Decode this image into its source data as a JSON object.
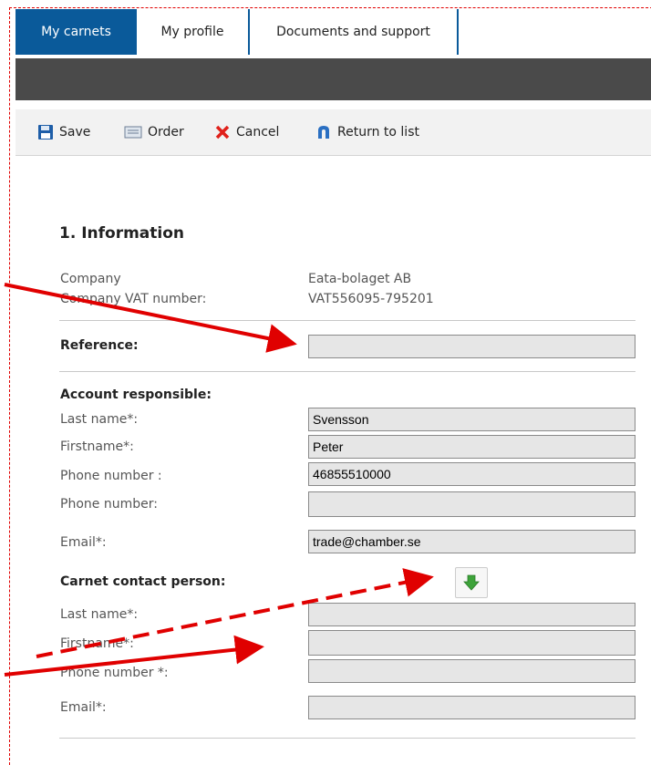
{
  "tabs": [
    "My carnets",
    "My profile",
    "Documents and support"
  ],
  "toolbar": {
    "save": "Save",
    "order": "Order",
    "cancel": "Cancel",
    "return": "Return to list"
  },
  "section_title": "1. Information",
  "company": {
    "label": "Company",
    "value": "Eata-bolaget AB"
  },
  "vat": {
    "label": "Company VAT number:",
    "value": "VAT556095-795201"
  },
  "reference": {
    "label": "Reference:",
    "value": ""
  },
  "account": {
    "title": "Account responsible:",
    "last_name": {
      "label": "Last name*:",
      "value": "Svensson"
    },
    "first_name": {
      "label": "Firstname*:",
      "value": "Peter"
    },
    "phone1": {
      "label": "Phone number :",
      "value": "46855510000"
    },
    "phone2": {
      "label": "Phone number:",
      "value": ""
    },
    "email": {
      "label": "Email*:",
      "value": "trade@chamber.se"
    }
  },
  "contact": {
    "title": "Carnet contact person:",
    "last_name": {
      "label": "Last name*:",
      "value": ""
    },
    "first_name": {
      "label": "Firstname*:",
      "value": ""
    },
    "phone": {
      "label": "Phone number *:",
      "value": ""
    },
    "email": {
      "label": "Email*:",
      "value": ""
    }
  },
  "icons": {
    "save": "floppy-disk-icon",
    "order": "order-icon",
    "cancel": "red-x-icon",
    "return": "return-arrow-icon",
    "copy": "green-down-arrow-icon"
  },
  "colors": {
    "tab_active": "#0a5a9a",
    "annotation": "#e00000",
    "field_bg": "#e6e6e6"
  }
}
